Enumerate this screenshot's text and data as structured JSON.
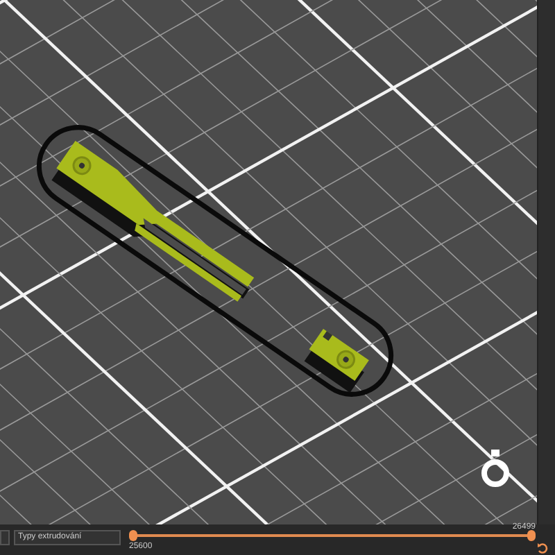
{
  "extrusion_type_field": {
    "value": "Typy extrudování"
  },
  "layer_slider": {
    "thumbs": [
      {
        "label": "25600",
        "level": 0
      },
      {
        "label": "26499",
        "level": 1
      }
    ]
  }
}
